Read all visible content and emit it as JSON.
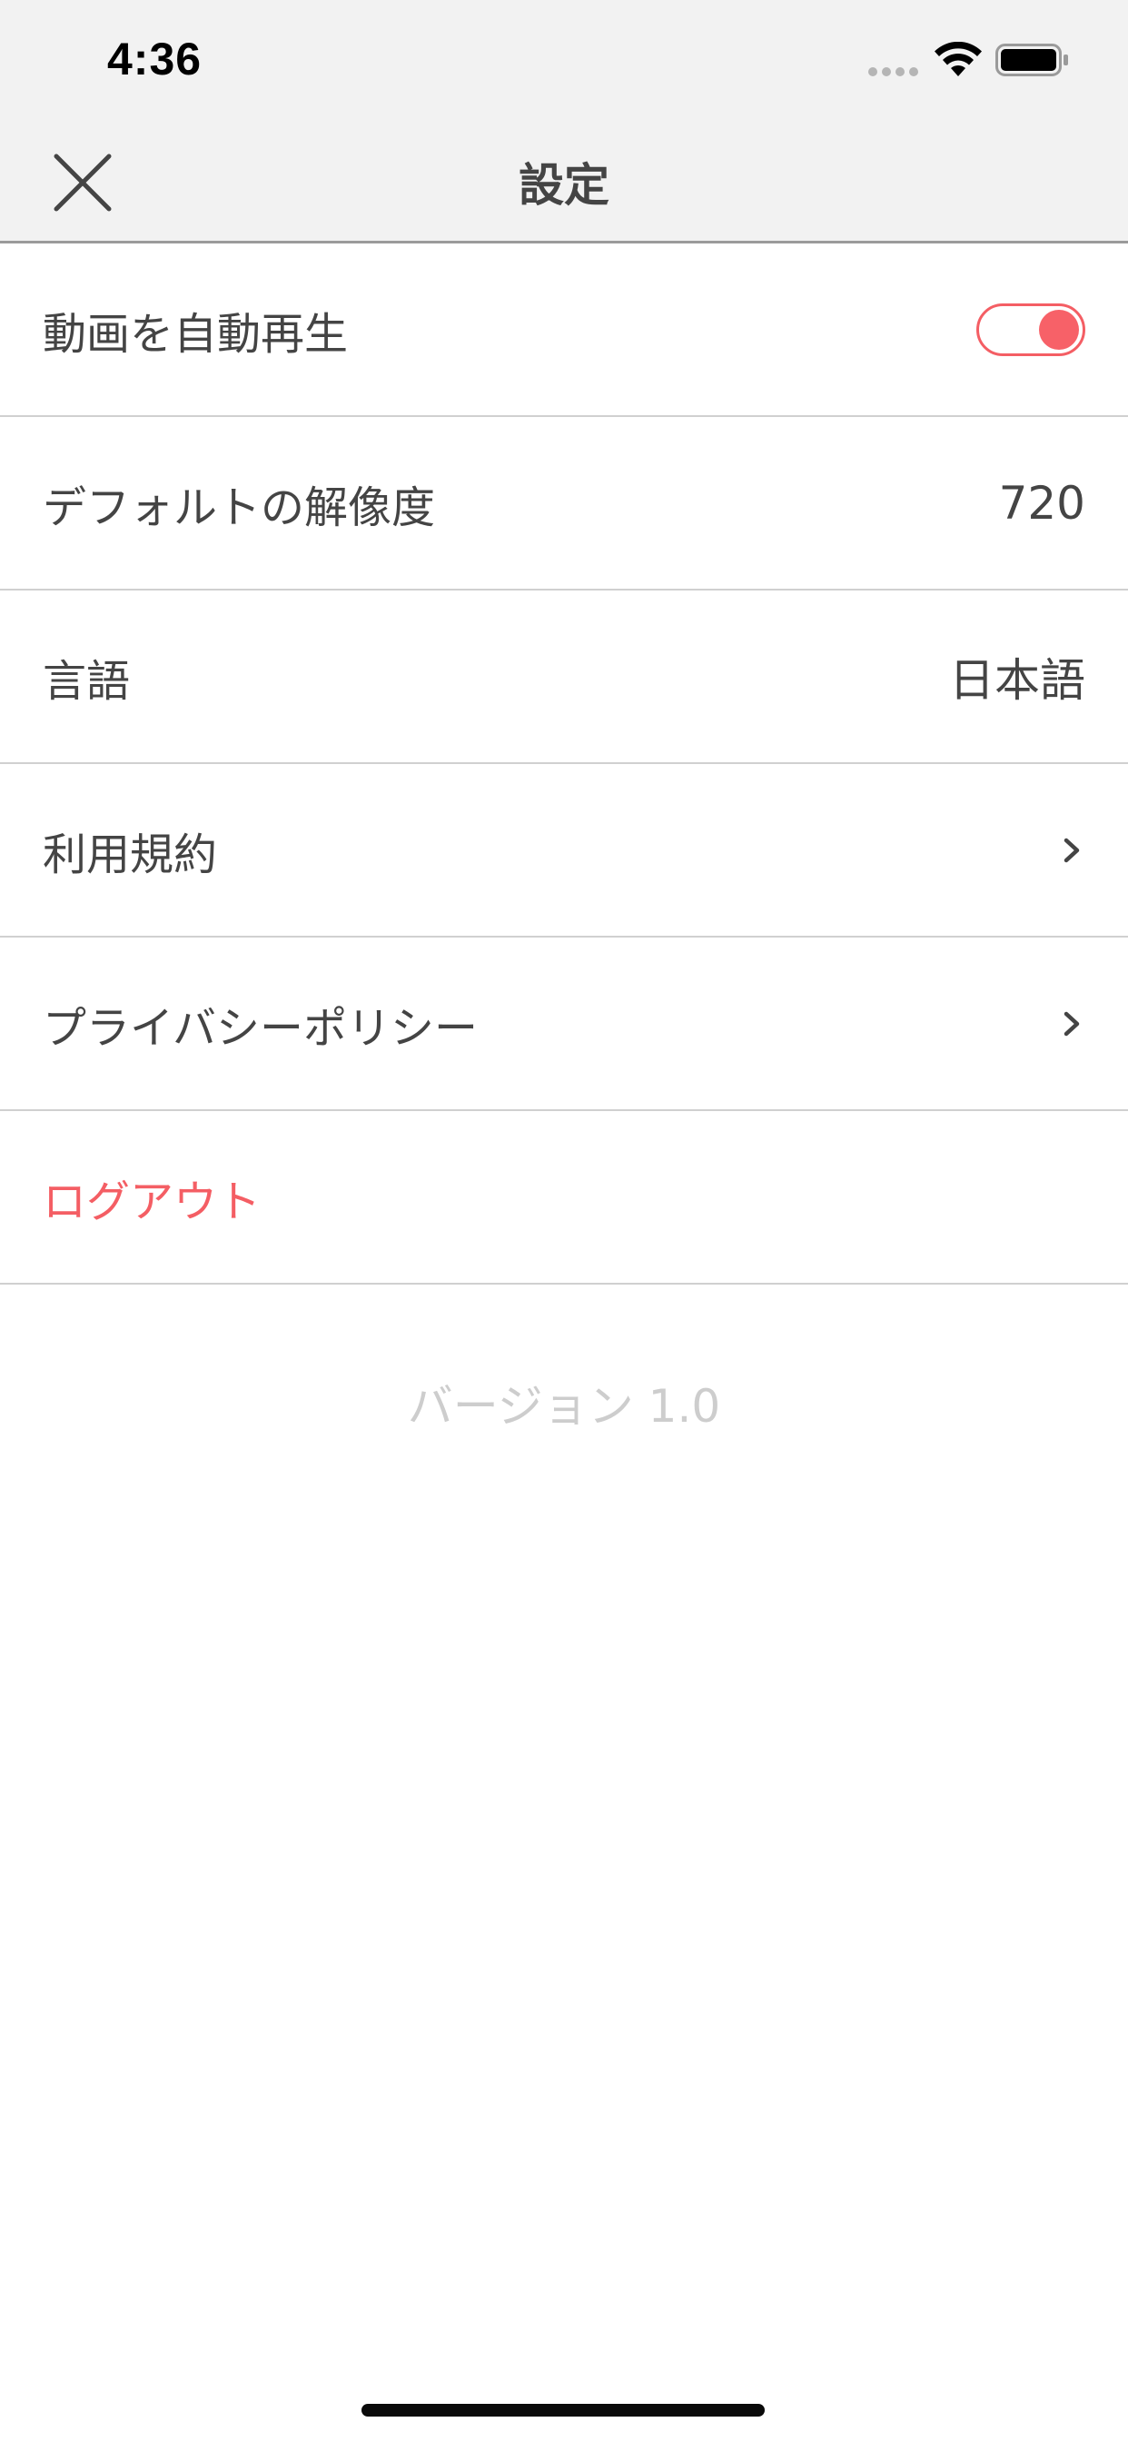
{
  "status_bar": {
    "time": "4:36"
  },
  "nav": {
    "title": "設定"
  },
  "settings": {
    "autoplay": {
      "label": "動画を自動再生",
      "enabled": true
    },
    "resolution": {
      "label": "デフォルトの解像度",
      "value": "720"
    },
    "language": {
      "label": "言語",
      "value": "日本語"
    },
    "terms": {
      "label": "利用規約"
    },
    "privacy": {
      "label": "プライバシーポリシー"
    },
    "logout": {
      "label": "ログアウト"
    }
  },
  "footer": {
    "version": "バージョン 1.0"
  },
  "colors": {
    "accent": "#f45e64",
    "nav_background": "#f2f2f2",
    "text": "#444444",
    "muted": "#cdcdcd"
  }
}
